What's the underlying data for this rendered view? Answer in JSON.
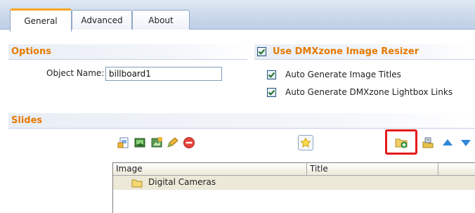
{
  "tabs": [
    {
      "label": "General",
      "active": true
    },
    {
      "label": "Advanced",
      "active": false
    },
    {
      "label": "About",
      "active": false
    }
  ],
  "options": {
    "header": "Options",
    "object_name_label": "Object Name:",
    "object_name_value": "billboard1"
  },
  "resizer": {
    "header": "Use DMXzone Image Resizer",
    "checked": true,
    "auto_titles_label": "Auto Generate Image Titles",
    "auto_titles_checked": true,
    "auto_lightbox_label": "Auto Generate DMXzone Lightbox Links",
    "auto_lightbox_checked": true
  },
  "slides": {
    "header": "Slides",
    "toolbar_icons": [
      "add-image-icon",
      "edit-image-icon",
      "replace-image-icon",
      "pencil-icon",
      "delete-icon",
      "star-icon",
      "add-folder-icon",
      "move-to-folder-icon",
      "move-up-icon",
      "move-down-icon"
    ],
    "grid": {
      "columns": [
        "Image",
        "Title"
      ],
      "rows": [
        {
          "image": "Digital Cameras",
          "title": "",
          "type": "folder"
        }
      ]
    }
  },
  "colors": {
    "accent": "#e67a00",
    "highlight": "#e41b1b",
    "tab_active_top": "#f6a623"
  }
}
